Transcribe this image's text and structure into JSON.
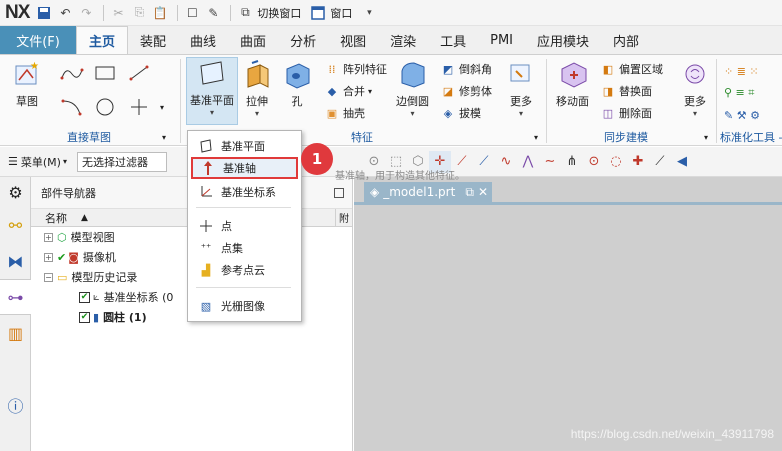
{
  "titlebar": {
    "logo": "NX",
    "switch_window": "切换窗口",
    "window_menu": "窗口"
  },
  "tabs": [
    "文件(F)",
    "主页",
    "装配",
    "曲线",
    "曲面",
    "分析",
    "视图",
    "渲染",
    "工具",
    "PMI",
    "应用模块",
    "内部"
  ],
  "active_tab": "主页",
  "ribbon": {
    "sketch": "草图",
    "group_direct_sketch": "直接草图",
    "datum_plane": "基准平面",
    "extrude": "拉伸",
    "hole": "孔",
    "array_feature": "阵列特征",
    "unite": "合并",
    "shell": "抽壳",
    "edge_blend": "边倒圆",
    "chamfer": "倒斜角",
    "trim_body": "修剪体",
    "draft": "拔模",
    "more": "更多",
    "group_feature": "特征",
    "move_face": "移动面",
    "offset_region": "偏置区域",
    "replace_face": "替换面",
    "delete_face": "删除面",
    "more2": "更多",
    "group_sync": "同步建模",
    "group_std": "标准化工具 -"
  },
  "selbar": {
    "menu": "菜单(M)",
    "filter": "无选择过滤器"
  },
  "navigator": {
    "title": "部件导航器",
    "col_name": "名称",
    "col_extra": "附",
    "rows": [
      {
        "label": "模型视图"
      },
      {
        "label": "摄像机"
      },
      {
        "label": "模型历史记录"
      },
      {
        "label": "基准坐标系 (0"
      },
      {
        "label": "圆柱 (1)"
      }
    ]
  },
  "graphics": {
    "tab": "_model1.prt",
    "tooltip": "基准轴，用于构造其他特征。"
  },
  "dropdown": {
    "items": [
      "基准平面",
      "基准轴",
      "基准坐标系",
      "点",
      "点集",
      "参考点云",
      "光栅图像"
    ],
    "selected": "基准轴"
  },
  "badge": "1",
  "watermark": "https://blog.csdn.net/weixin_43911798",
  "colors": {
    "accent": "#1e5aa0",
    "file_tab": "#4a90b8",
    "badge": "#e0393d",
    "graphics_bg": "#cfcfcf"
  }
}
